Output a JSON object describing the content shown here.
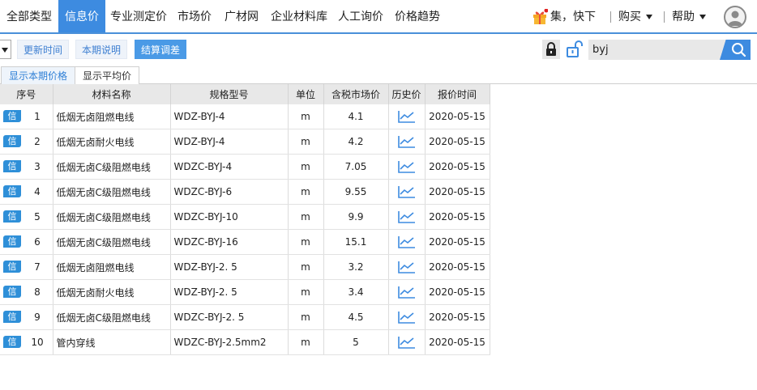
{
  "nav": {
    "items": [
      {
        "label": "全部类型",
        "active": false
      },
      {
        "label": "信息价",
        "active": true
      },
      {
        "label": "专业测定价",
        "active": false
      },
      {
        "label": "市场价",
        "active": false
      },
      {
        "label": "广材网",
        "active": false
      },
      {
        "label": "企业材料库",
        "active": false
      },
      {
        "label": "人工询价",
        "active": false
      },
      {
        "label": "价格趋势",
        "active": false
      }
    ],
    "promo_text": "集，快下",
    "buy_label": "购买",
    "help_label": "帮助"
  },
  "toolbar": {
    "update_time_label": "更新时间",
    "period_note_label": "本期说明",
    "settle_adjust_label": "结算调差",
    "search_value": "byj"
  },
  "tabs": [
    {
      "label": "显示本期价格",
      "active": true
    },
    {
      "label": "显示平均价",
      "active": false
    }
  ],
  "table": {
    "headers": {
      "no": "序号",
      "name": "材料名称",
      "spec": "规格型号",
      "unit": "单位",
      "price": "含税市场价",
      "history": "历史价",
      "date": "报价时间"
    },
    "badge_label": "信",
    "rows": [
      {
        "no": "1",
        "name": "低烟无卤阻燃电线",
        "spec": "WDZ-BYJ-4",
        "unit": "m",
        "price": "4.1",
        "date": "2020-05-15"
      },
      {
        "no": "2",
        "name": "低烟无卤耐火电线",
        "spec": "WDZ-BYJ-4",
        "unit": "m",
        "price": "4.2",
        "date": "2020-05-15"
      },
      {
        "no": "3",
        "name": "低烟无卤C级阻燃电线",
        "spec": "WDZC-BYJ-4",
        "unit": "m",
        "price": "7.05",
        "date": "2020-05-15"
      },
      {
        "no": "4",
        "name": "低烟无卤C级阻燃电线",
        "spec": "WDZC-BYJ-6",
        "unit": "m",
        "price": "9.55",
        "date": "2020-05-15"
      },
      {
        "no": "5",
        "name": "低烟无卤C级阻燃电线",
        "spec": "WDZC-BYJ-10",
        "unit": "m",
        "price": "9.9",
        "date": "2020-05-15"
      },
      {
        "no": "6",
        "name": "低烟无卤C级阻燃电线",
        "spec": "WDZC-BYJ-16",
        "unit": "m",
        "price": "15.1",
        "date": "2020-05-15"
      },
      {
        "no": "7",
        "name": "低烟无卤阻燃电线",
        "spec": "WDZ-BYJ-2. 5",
        "unit": "m",
        "price": "3.2",
        "date": "2020-05-15"
      },
      {
        "no": "8",
        "name": "低烟无卤耐火电线",
        "spec": "WDZ-BYJ-2. 5",
        "unit": "m",
        "price": "3.4",
        "date": "2020-05-15"
      },
      {
        "no": "9",
        "name": "低烟无卤C级阻燃电线",
        "spec": "WDZC-BYJ-2. 5",
        "unit": "m",
        "price": "4.5",
        "date": "2020-05-15"
      },
      {
        "no": "10",
        "name": "管内穿线",
        "spec": "WDZC-BYJ-2.5mm2",
        "unit": "m",
        "price": "5",
        "date": "2020-05-15"
      }
    ]
  },
  "colors": {
    "accent": "#3d8be0",
    "badge": "#2e8fd8",
    "trend_icon": "#3d8be0"
  },
  "icons": {
    "gift": "gift-icon",
    "avatar": "user-avatar-icon",
    "lock": "lock-icon",
    "unlock": "unlock-icon",
    "search": "search-icon",
    "history": "trend-chart-icon"
  }
}
